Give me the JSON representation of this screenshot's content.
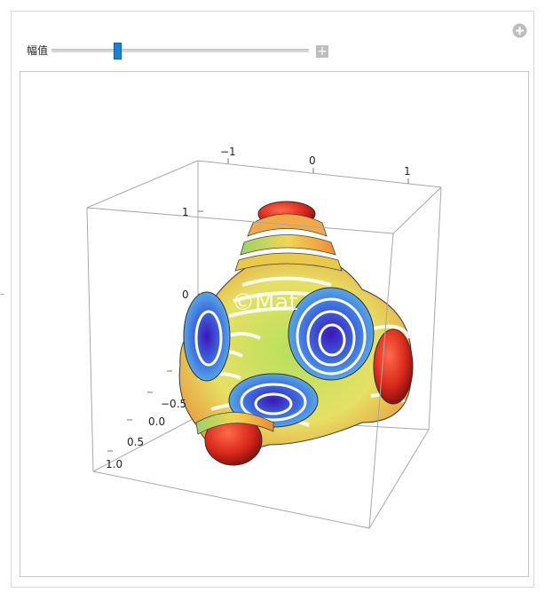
{
  "control": {
    "label": "幅值",
    "slider_value_fraction": 0.25,
    "plus_symbol": "+"
  },
  "plot": {
    "type": "3d-surface",
    "watermark": "©Mat",
    "axes": {
      "top_ticks": [
        "−1",
        "0",
        "1"
      ],
      "left_ticks": [
        "1",
        "0"
      ],
      "front_ticks": [
        "−0.5",
        "0.0",
        "0.5",
        "1.0"
      ]
    },
    "colors": {
      "accent": "#1b82d9",
      "box_edge": "#9a9a9a"
    }
  },
  "side_mark": "–"
}
